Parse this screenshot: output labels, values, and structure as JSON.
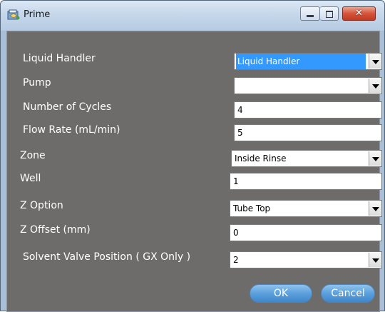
{
  "window": {
    "title": "Prime"
  },
  "fields": [
    {
      "label": "Liquid Handler",
      "value": "Liquid Handler"
    },
    {
      "label": "Pump",
      "value": ""
    },
    {
      "label": "Number of Cycles",
      "value": "4"
    },
    {
      "label": "Flow Rate (mL/min)",
      "value": "5"
    },
    {
      "label": "Zone",
      "value": "Inside Rinse"
    },
    {
      "label": "Well",
      "value": "1"
    },
    {
      "label": "Z Option",
      "value": "Tube Top"
    },
    {
      "label": "Z Offset (mm)",
      "value": "0"
    },
    {
      "label": "Solvent Valve Position ( GX Only )",
      "value": "2"
    }
  ],
  "buttons": {
    "ok": "OK",
    "cancel": "Cancel"
  },
  "icons": {
    "app": "prime-app-icon",
    "minimize": "minimize-icon",
    "maximize": "maximize-icon",
    "close": "close-icon",
    "dropdown": "chevron-down-icon"
  },
  "colors": {
    "titlebar": "#c6d7ea",
    "panel": "#6d6c6b",
    "close": "#c23a20",
    "selection": "#3399ff",
    "button": "#5c9fdb"
  }
}
